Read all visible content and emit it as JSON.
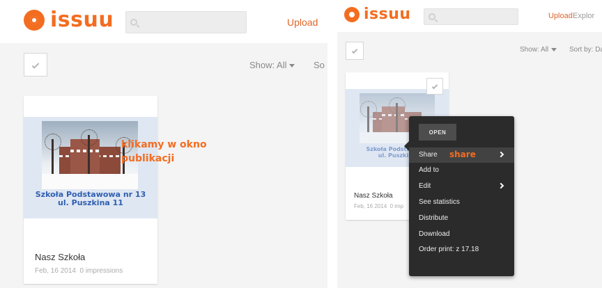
{
  "left": {
    "logo": "issuu",
    "upload": "Upload",
    "show": "Show: All",
    "sort": "So",
    "doc": {
      "cover_caption_1": "Szkoła Podstawowa nr 13",
      "cover_caption_2": "ul. Puszkina 11",
      "title": "Nasz Szkoła",
      "date": "Feb, 16 2014",
      "impressions": "0 impressions"
    },
    "annotation": "klikamy w okno publikacji"
  },
  "right": {
    "logo": "issuu",
    "upload": "Upload",
    "explore": "Explor",
    "show": "Show: All",
    "sort": "Sort by: Da",
    "doc": {
      "cover_caption_1": "Szkoła Podstawowa",
      "cover_caption_2": "ul. Puszkina",
      "title": "Nasz Szkoła",
      "date": "Feb, 16 2014",
      "impressions": "0 imp"
    },
    "menu": {
      "open": "OPEN",
      "items": [
        "Share",
        "Add to",
        "Edit",
        "See statistics",
        "Distribute",
        "Download",
        "Order print: z 17.18"
      ],
      "annotation": "share"
    }
  },
  "colors": {
    "brand": "#f36d21",
    "menu_bg": "#2b2b2b",
    "background": "#f4f4f4"
  }
}
